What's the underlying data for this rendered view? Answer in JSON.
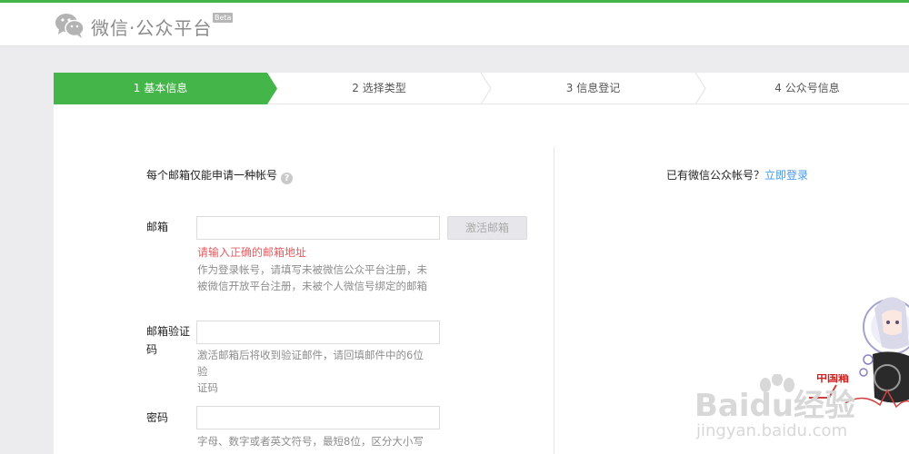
{
  "header": {
    "brand": "微信·公众平台",
    "beta": "Beta"
  },
  "steps": [
    {
      "label": "1 基本信息",
      "active": true
    },
    {
      "label": "2 选择类型",
      "active": false
    },
    {
      "label": "3 信息登记",
      "active": false
    },
    {
      "label": "4 公众号信息",
      "active": false
    }
  ],
  "form": {
    "intro": "每个邮箱仅能申请一种帐号",
    "help_icon": "?",
    "email": {
      "label": "邮箱",
      "value": "",
      "button": "激活邮箱",
      "error": "请输入正确的邮箱地址",
      "hint_1": "作为登录帐号，请填写未被微信公众平台注册，未",
      "hint_2": "被微信开放平台注册，未被个人微信号绑定的邮箱"
    },
    "code": {
      "label_1": "邮箱验证",
      "label_2": "码",
      "value": "",
      "hint_1": "激活邮箱后将收到验证邮件，请回填邮件中的6位验",
      "hint_2": "证码"
    },
    "password": {
      "label": "密码",
      "value": "",
      "hint": "字母、数字或者英文符号，最短8位，区分大小写"
    }
  },
  "side": {
    "prompt": "已有微信公众帐号？",
    "link": "立即登录"
  },
  "watermark": {
    "brand": "Baidu经验",
    "url": "jingyan.baidu.com",
    "stamp": "中国箱"
  },
  "colors": {
    "accent": "#44b549",
    "error": "#e15f63",
    "link": "#459ae9"
  }
}
